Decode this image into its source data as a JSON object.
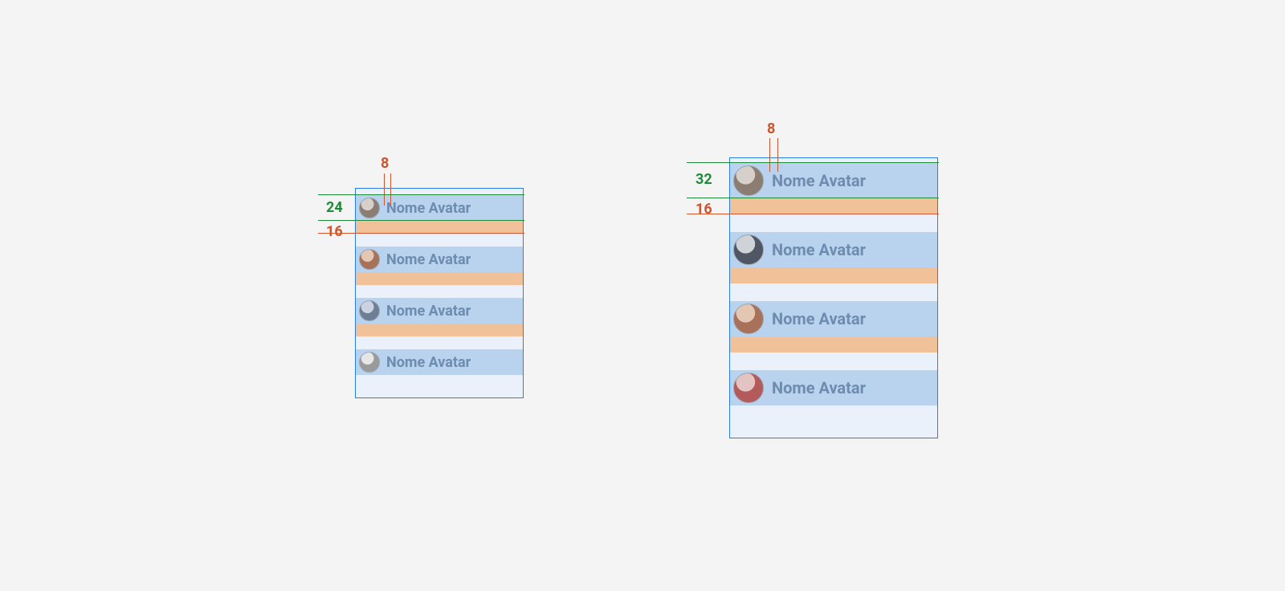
{
  "panelA": {
    "spacing_label_top": "8",
    "row_height_label": "24",
    "row_gap_label": "16",
    "rows": [
      {
        "label": "Nome Avatar"
      },
      {
        "label": "Nome Avatar"
      },
      {
        "label": "Nome Avatar"
      },
      {
        "label": "Nome Avatar"
      }
    ]
  },
  "panelB": {
    "spacing_label_top": "8",
    "row_height_label": "32",
    "row_gap_label": "16",
    "rows": [
      {
        "label": "Nome Avatar"
      },
      {
        "label": "Nome Avatar"
      },
      {
        "label": "Nome Avatar"
      },
      {
        "label": "Nome Avatar"
      }
    ]
  }
}
